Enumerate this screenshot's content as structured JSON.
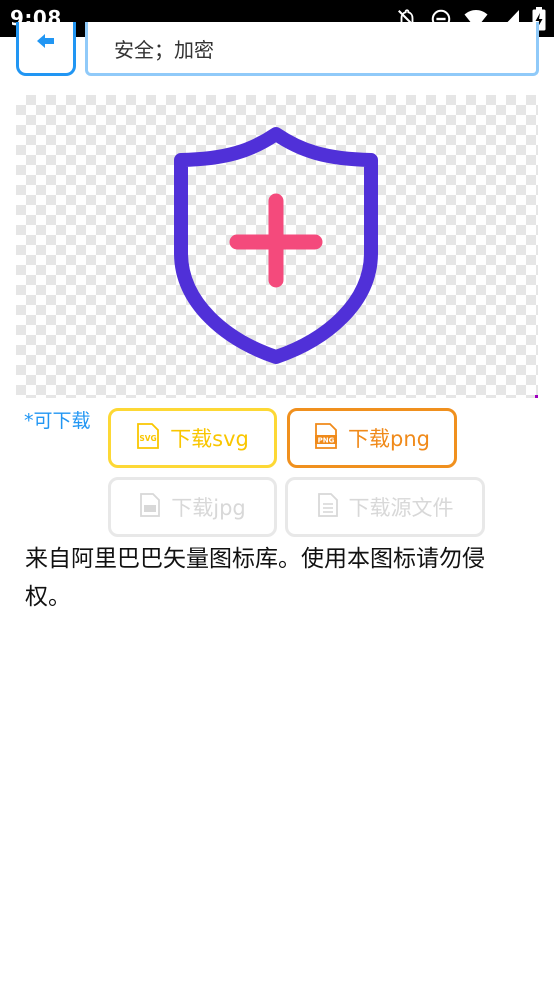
{
  "status_bar": {
    "time": "9:08",
    "icons": [
      "notifications-off-icon",
      "do-not-disturb-icon",
      "wifi-icon",
      "cellular-signal-icon",
      "battery-charging-icon"
    ]
  },
  "search": {
    "query": "安全；加密"
  },
  "back": {
    "icon": "arrow-left-icon"
  },
  "preview": {
    "icon": "shield-plus-icon",
    "shield_color": "#5030d8",
    "plus_color": "#f44a7c"
  },
  "downloads": {
    "label": "*可下载",
    "svg_label": "下载svg",
    "png_label": "下载png",
    "jpg_label": "下载jpg",
    "source_label": "下载源文件",
    "svg_color": "#f9c600",
    "png_color": "#f08a1a",
    "disabled_color": "#d8d8d8"
  },
  "notice": {
    "text": "来自阿里巴巴矢量图标库。使用本图标请勿侵权。"
  }
}
